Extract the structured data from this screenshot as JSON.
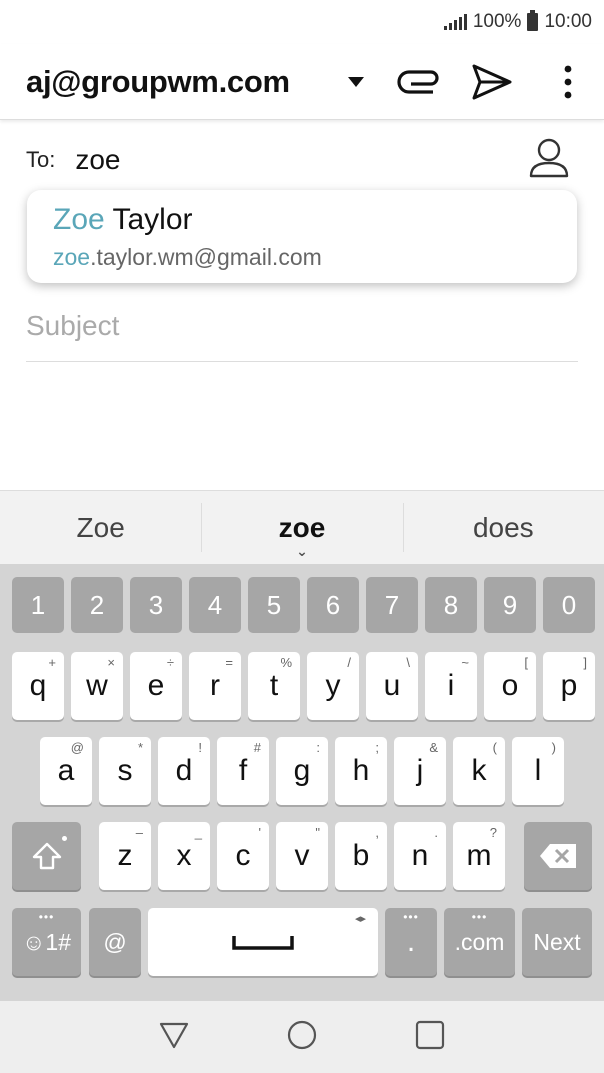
{
  "status_bar": {
    "battery": "100%",
    "time": "10:00"
  },
  "app_bar": {
    "from_account": "aj@groupwm.com"
  },
  "compose": {
    "to_label": "To:",
    "to_value": "zoe",
    "subject_placeholder": "Subject"
  },
  "autocomplete": {
    "name_match": "Zoe",
    "name_rest": " Taylor",
    "email_match": "zoe",
    "email_rest": ".taylor.wm@gmail.com"
  },
  "suggestions": [
    "Zoe",
    "zoe",
    "does"
  ],
  "keyboard": {
    "numbers": [
      "1",
      "2",
      "3",
      "4",
      "5",
      "6",
      "7",
      "8",
      "9",
      "0"
    ],
    "row1": [
      {
        "k": "q",
        "s": "+"
      },
      {
        "k": "w",
        "s": "×"
      },
      {
        "k": "e",
        "s": "÷"
      },
      {
        "k": "r",
        "s": "="
      },
      {
        "k": "t",
        "s": "%"
      },
      {
        "k": "y",
        "s": "/"
      },
      {
        "k": "u",
        "s": "\\"
      },
      {
        "k": "i",
        "s": "~"
      },
      {
        "k": "o",
        "s": "["
      },
      {
        "k": "p",
        "s": "]"
      }
    ],
    "row2": [
      {
        "k": "a",
        "s": "@"
      },
      {
        "k": "s",
        "s": "*"
      },
      {
        "k": "d",
        "s": "!"
      },
      {
        "k": "f",
        "s": "#"
      },
      {
        "k": "g",
        "s": ":"
      },
      {
        "k": "h",
        "s": ";"
      },
      {
        "k": "j",
        "s": "&"
      },
      {
        "k": "k",
        "s": "("
      },
      {
        "k": "l",
        "s": ")"
      }
    ],
    "row3": [
      {
        "k": "z",
        "s": "–"
      },
      {
        "k": "x",
        "s": "_"
      },
      {
        "k": "c",
        "s": "'"
      },
      {
        "k": "v",
        "s": "\""
      },
      {
        "k": "b",
        "s": ","
      },
      {
        "k": "n",
        "s": "."
      },
      {
        "k": "m",
        "s": "?"
      }
    ],
    "symbols_label": "☺1#",
    "at_label": "@",
    "period_label": ".",
    "dotcom_label": ".com",
    "next_label": "Next"
  }
}
